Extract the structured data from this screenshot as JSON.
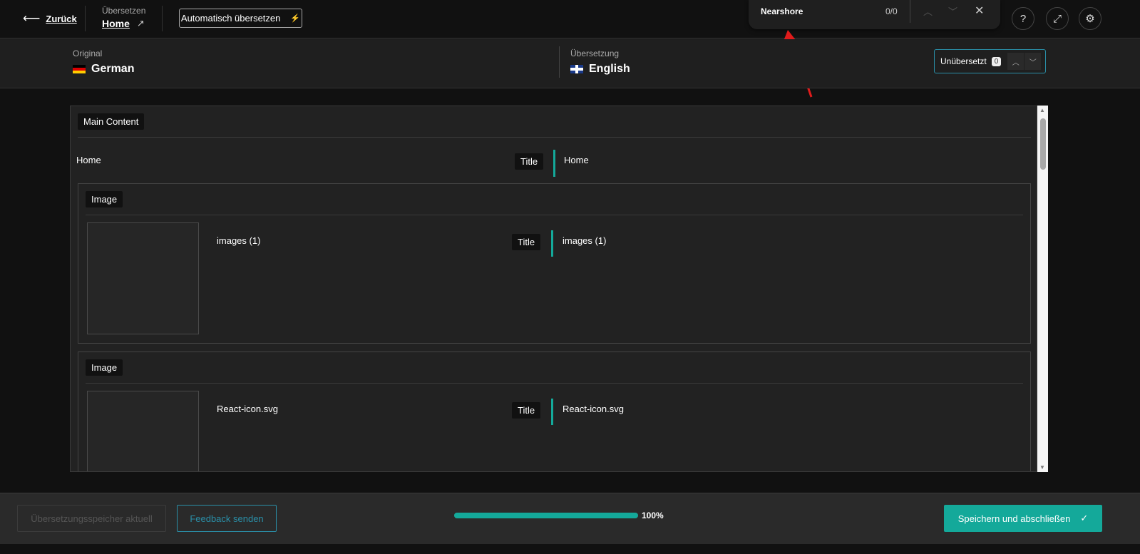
{
  "header": {
    "back_label": "Zurück",
    "section_label": "Übersetzen",
    "page_name": "Home",
    "auto_translate_label": "Automatisch übersetzen"
  },
  "search": {
    "query": "Nearshore",
    "count": "0/0"
  },
  "languages": {
    "original_label": "Original",
    "original_name": "German",
    "translation_label": "Übersetzung",
    "translation_name": "English",
    "untranslated_label": "Unübersetzt",
    "untranslated_count": "0"
  },
  "content": {
    "main_tag": "Main Content",
    "home_row": {
      "source": "Home",
      "field": "Title",
      "target": "Home"
    },
    "images": [
      {
        "tag": "Image",
        "source": "images (1)",
        "field": "Title",
        "target": "images (1)"
      },
      {
        "tag": "Image",
        "source": "React-icon.svg",
        "field": "Title",
        "target": "React-icon.svg"
      }
    ]
  },
  "footer": {
    "memory_label": "Übersetzungsspeicher aktuell",
    "feedback_label": "Feedback senden",
    "progress": 100,
    "progress_label": "100%",
    "save_label": "Speichern und abschließen"
  },
  "colors": {
    "accent": "#14a99a",
    "feedback": "#2a8fa8"
  }
}
